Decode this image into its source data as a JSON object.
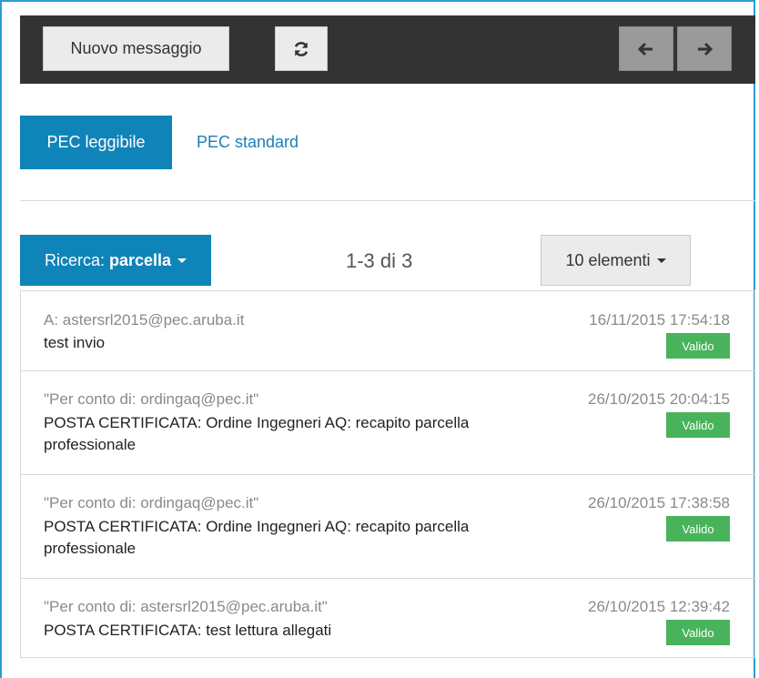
{
  "toolbar": {
    "new_message_label": "Nuovo messaggio",
    "refresh_icon": "refresh-icon",
    "prev_icon": "arrow-left-icon",
    "next_icon": "arrow-right-icon"
  },
  "tabs": [
    {
      "label": "PEC leggibile",
      "active": true
    },
    {
      "label": "PEC standard",
      "active": false
    }
  ],
  "filters": {
    "search_prefix": "Ricerca:",
    "search_term": "parcella",
    "page_count": "1-3 di 3",
    "per_page_label": "10 elementi"
  },
  "colors": {
    "toolbar_bg": "#333333",
    "accent": "#0f84b9",
    "badge": "#48b35a",
    "frame": "#2d9bd2"
  },
  "messages": [
    {
      "from": "A: astersrl2015@pec.aruba.it",
      "subject": "test invio",
      "date": "16/11/2015 17:54:18",
      "status": "Valido"
    },
    {
      "from": "\"Per conto di: ordingaq@pec.it\"",
      "subject": "POSTA CERTIFICATA: Ordine Ingegneri AQ: recapito parcella professionale",
      "date": "26/10/2015 20:04:15",
      "status": "Valido"
    },
    {
      "from": "\"Per conto di: ordingaq@pec.it\"",
      "subject": "POSTA CERTIFICATA: Ordine Ingegneri AQ: recapito parcella professionale",
      "date": "26/10/2015 17:38:58",
      "status": "Valido"
    },
    {
      "from": "\"Per conto di: astersrl2015@pec.aruba.it\"",
      "subject": "POSTA CERTIFICATA: test lettura allegati",
      "date": "26/10/2015 12:39:42",
      "status": "Valido"
    }
  ]
}
